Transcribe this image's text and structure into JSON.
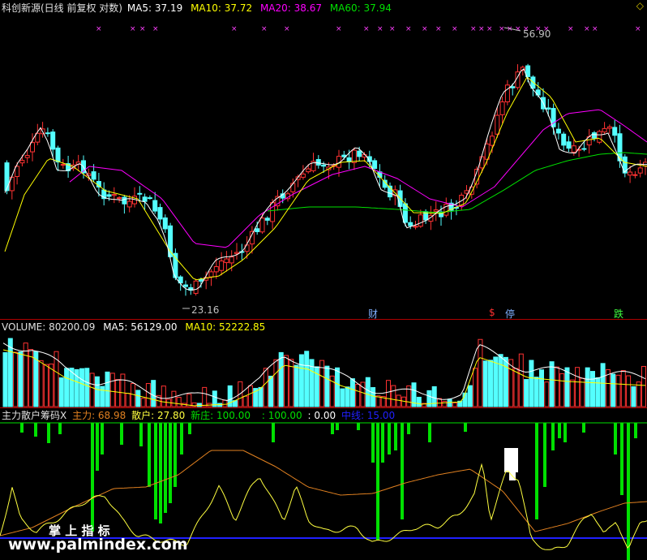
{
  "main_header": {
    "title": "科创新源(日线 前复权 对数)",
    "ma5": "MA5: 37.19",
    "ma10": "MA10: 37.72",
    "ma20": "MA20: 38.67",
    "ma60": "MA60: 37.94"
  },
  "price_annotations": {
    "high": "56.90",
    "low": "23.16"
  },
  "event_tags": {
    "cai": "财",
    "dollar": "$",
    "ting": "停",
    "die": "跌"
  },
  "volume_header": {
    "label": "VOLUME: 80200.09",
    "ma5": "MA5: 56129.00",
    "ma10": "MA10: 52222.85"
  },
  "indicator_header": {
    "name": "主力散户筹码X",
    "zhuli": "主力: 68.98",
    "sanhu": "散户: 27.80",
    "xinzhuang": "新庄: 100.00",
    "v100": ": 100.00",
    "v0": ": 0.00",
    "zhongxian": "中线: 15.00"
  },
  "watermark": {
    "line1": "掌 上 指 标",
    "line2": "www.palmindex.com"
  },
  "colors": {
    "up": "#ff3232",
    "down": "#54ffff",
    "ma5": "#ffffff",
    "ma10": "#ffff00",
    "ma20": "#ff00ff",
    "ma60": "#00e000",
    "zhongxian": "#2020ff",
    "bars": "#00e000",
    "sanhu": "#ffff40",
    "zhuli": "#e08020"
  },
  "chart_data": [
    {
      "type": "candlestick",
      "title": "科创新源(日线 前复权 对数)",
      "high_label": 56.9,
      "low_label": 23.16,
      "moving_averages": [
        "MA5",
        "MA10",
        "MA20",
        "MA60"
      ],
      "ma_last": {
        "MA5": 37.19,
        "MA10": 37.72,
        "MA20": 38.67,
        "MA60": 37.94
      }
    },
    {
      "type": "bar",
      "title": "VOLUME",
      "last_value": 80200.09,
      "ma5_last": 56129.0,
      "ma10_last": 52222.85
    },
    {
      "type": "line",
      "title": "主力散户筹码X",
      "series": [
        {
          "name": "主力",
          "last": 68.98
        },
        {
          "name": "散户",
          "last": 27.8
        },
        {
          "name": "新庄",
          "last": 100.0
        },
        {
          "name": "中线",
          "last": 15.0
        }
      ]
    }
  ]
}
